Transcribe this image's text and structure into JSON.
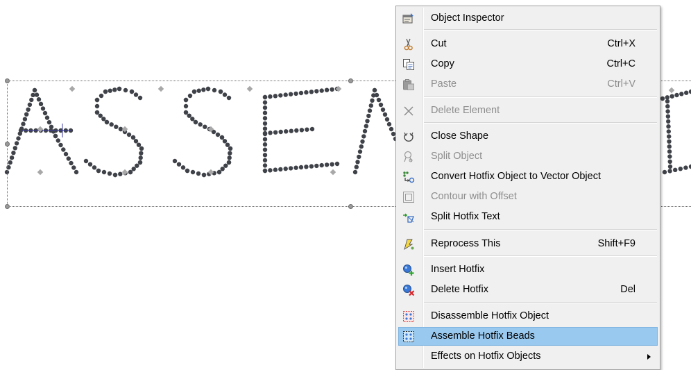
{
  "canvas": {
    "text_object": "ASSEMBLE",
    "bead_color": "#3f4248",
    "guide_color": "#3a3aa0"
  },
  "context_menu": {
    "items": [
      {
        "label": "Object Inspector",
        "shortcut": "",
        "enabled": true,
        "icon": "object-inspector-icon"
      },
      {
        "label": "Cut",
        "shortcut": "Ctrl+X",
        "enabled": true,
        "icon": "scissors-icon"
      },
      {
        "label": "Copy",
        "shortcut": "Ctrl+C",
        "enabled": true,
        "icon": "copy-icon"
      },
      {
        "label": "Paste",
        "shortcut": "Ctrl+V",
        "enabled": false,
        "icon": "paste-icon"
      },
      {
        "label": "Delete Element",
        "shortcut": "",
        "enabled": false,
        "icon": "x-icon"
      },
      {
        "label": "Close Shape",
        "shortcut": "",
        "enabled": true,
        "icon": "close-shape-icon"
      },
      {
        "label": "Split Object",
        "shortcut": "",
        "enabled": false,
        "icon": "split-object-icon"
      },
      {
        "label": "Convert Hotfix Object to Vector Object",
        "shortcut": "",
        "enabled": true,
        "icon": "convert-vector-icon"
      },
      {
        "label": "Contour with Offset",
        "shortcut": "",
        "enabled": false,
        "icon": "contour-icon"
      },
      {
        "label": "Split Hotfix Text",
        "shortcut": "",
        "enabled": true,
        "icon": "split-text-icon"
      },
      {
        "label": "Reprocess This",
        "shortcut": "Shift+F9",
        "enabled": true,
        "icon": "reprocess-icon"
      },
      {
        "label": "Insert Hotfix",
        "shortcut": "",
        "enabled": true,
        "icon": "insert-hotfix-icon"
      },
      {
        "label": "Delete Hotfix",
        "shortcut": "Del",
        "enabled": true,
        "icon": "delete-hotfix-icon"
      },
      {
        "label": "Disassemble Hotfix Object",
        "shortcut": "",
        "enabled": true,
        "icon": "disassemble-icon"
      },
      {
        "label": "Assemble Hotfix Beads",
        "shortcut": "",
        "enabled": true,
        "icon": "assemble-icon",
        "highlighted": true
      },
      {
        "label": "Effects on Hotfix Objects",
        "shortcut": "",
        "enabled": true,
        "icon": "",
        "submenu": true
      }
    ],
    "highlight_color": "#99c9ef"
  }
}
